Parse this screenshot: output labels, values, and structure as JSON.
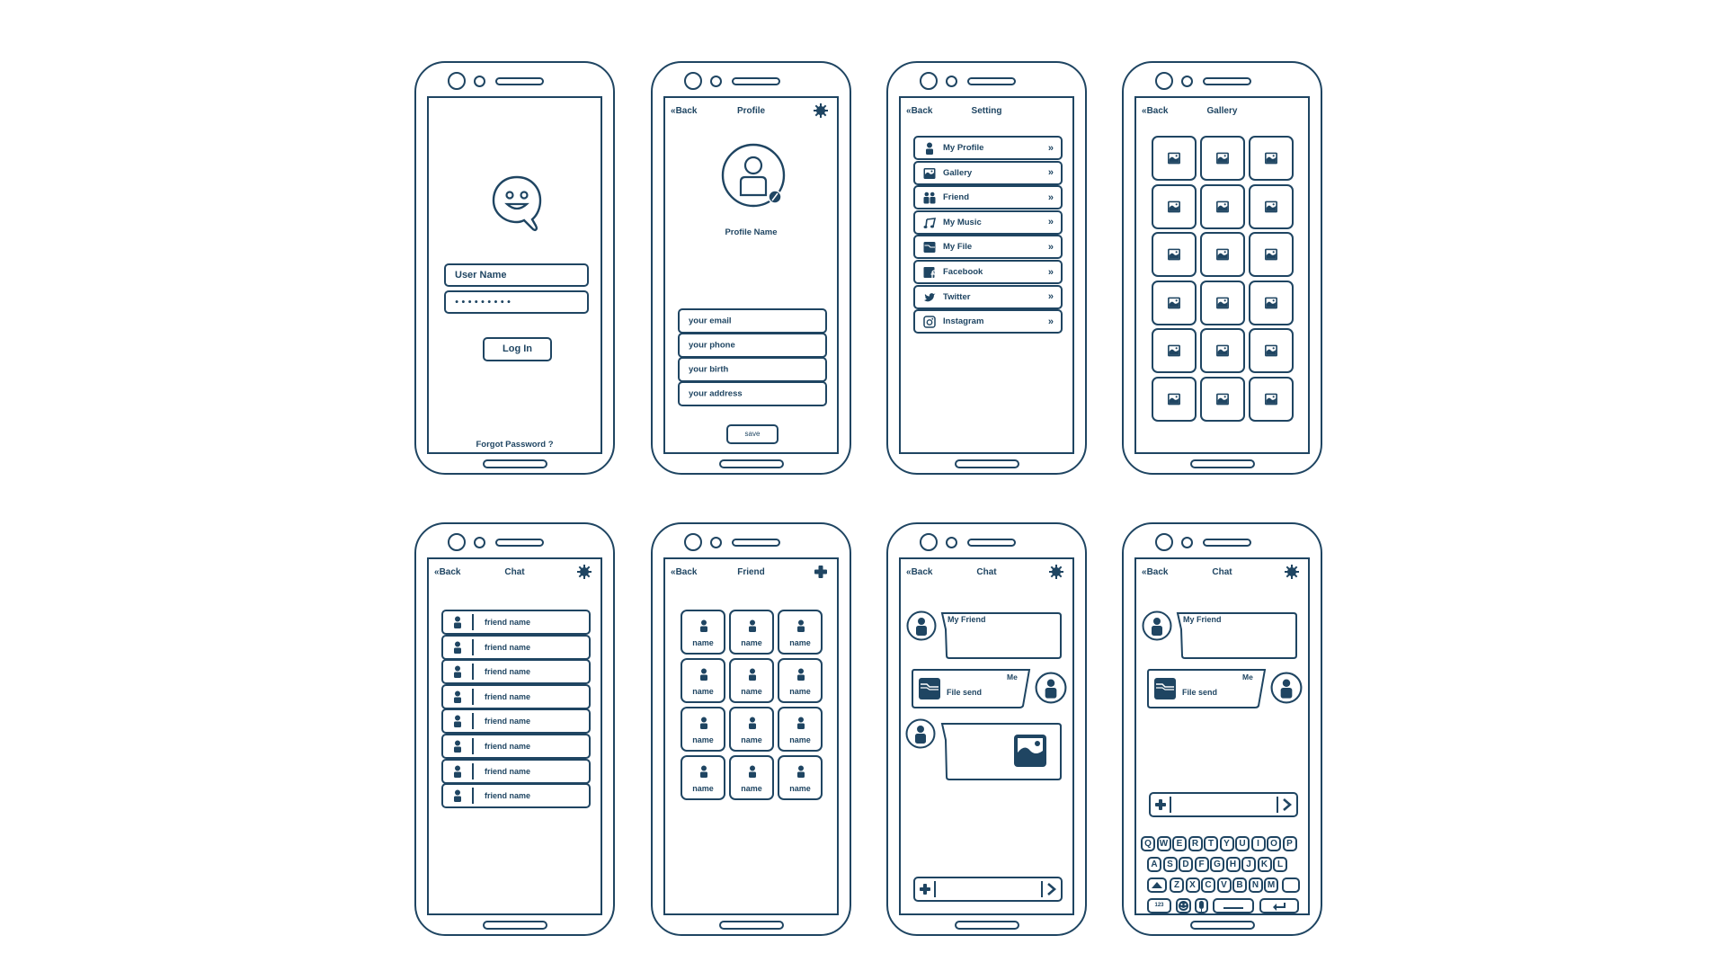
{
  "colors": {
    "stroke": "#1f4562",
    "background": "#ffffff"
  },
  "login": {
    "username_placeholder": "User Name",
    "password_mask": "●●●●●●●●●",
    "login_button": "Log In",
    "forgot_password": "Forgot Password ?",
    "logo_icon": "smiley-speech-bubble-icon"
  },
  "profile": {
    "back": "Back",
    "title": "Profile",
    "right_icon": "gear-icon",
    "avatar_icon": "user-edit-avatar-icon",
    "profile_name": "Profile Name",
    "fields": [
      "your email",
      "your phone",
      "your birth",
      "your address"
    ],
    "save_button": "save"
  },
  "settings": {
    "back": "Back",
    "title": "Setting",
    "items": [
      {
        "label": "My Profile",
        "icon": "user-icon"
      },
      {
        "label": "Gallery",
        "icon": "image-icon"
      },
      {
        "label": "Friend",
        "icon": "users-icon"
      },
      {
        "label": "My Music",
        "icon": "music-note-icon"
      },
      {
        "label": "My File",
        "icon": "folder-icon"
      },
      {
        "label": "Facebook",
        "icon": "facebook-icon"
      },
      {
        "label": "Twitter",
        "icon": "twitter-bird-icon"
      },
      {
        "label": "Instagram",
        "icon": "instagram-icon"
      }
    ],
    "chevron": "»"
  },
  "gallery": {
    "back": "Back",
    "title": "Gallery",
    "rows": 6,
    "cols": 3,
    "cell_icon": "image-icon"
  },
  "chat_list": {
    "back": "Back",
    "title": "Chat",
    "right_icon": "gear-icon",
    "friends": [
      "friend name",
      "friend name",
      "friend name",
      "friend name",
      "friend name",
      "friend name",
      "friend name",
      "friend name"
    ]
  },
  "friends": {
    "back": "Back",
    "title": "Friend",
    "right_icon": "plus-icon",
    "names": [
      "name",
      "name",
      "name",
      "name",
      "name",
      "name",
      "name",
      "name",
      "name",
      "name",
      "name",
      "name"
    ]
  },
  "chat": {
    "back": "Back",
    "title": "Chat",
    "right_icon": "gear-icon",
    "friend_label": "My Friend",
    "me_label": "Me",
    "file_send": "File send",
    "input_plus": "+",
    "input_send": "›"
  },
  "chat_keyboard": {
    "back": "Back",
    "title": "Chat",
    "right_icon": "gear-icon",
    "friend_label": "My Friend",
    "me_label": "Me",
    "file_send": "File send",
    "keys_row1": [
      "Q",
      "W",
      "E",
      "R",
      "T",
      "Y",
      "U",
      "I",
      "O",
      "P"
    ],
    "keys_row2": [
      "A",
      "S",
      "D",
      "F",
      "G",
      "H",
      "J",
      "K",
      "L"
    ],
    "keys_row3": [
      "Z",
      "X",
      "C",
      "V",
      "B",
      "N",
      "M"
    ],
    "numbers_key": "123"
  }
}
